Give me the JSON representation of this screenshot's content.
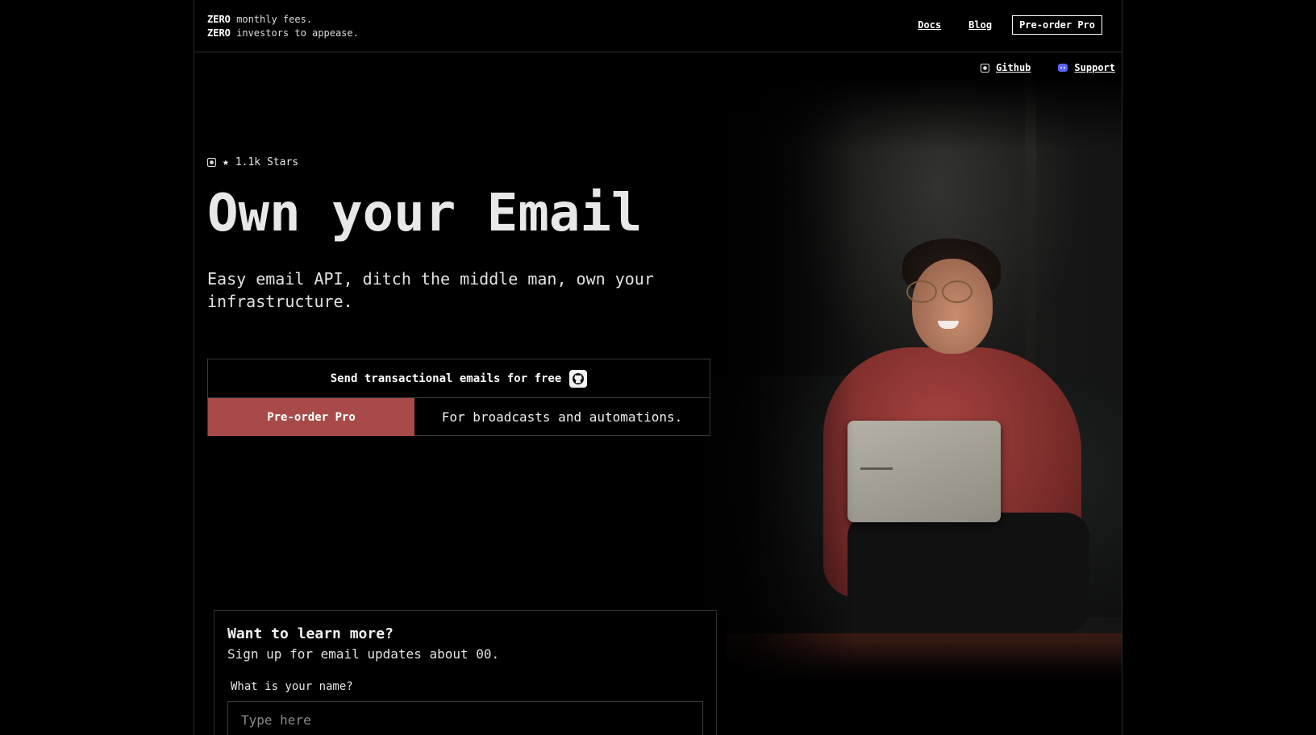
{
  "header": {
    "tagline_line1_bold": "ZERO",
    "tagline_line1_rest": " monthly fees.",
    "tagline_line2_bold": "ZERO",
    "tagline_line2_rest": " investors to appease.",
    "nav": {
      "docs": "Docs",
      "blog": "Blog",
      "preorder": "Pre-order Pro"
    },
    "subnav": {
      "github": "Github",
      "support": "Support"
    }
  },
  "hero": {
    "stars": "1.1k Stars",
    "title": "Own your Email",
    "subtitle": "Easy email API, ditch the middle man, own your infrastructure.",
    "cta_free": "Send transactional emails for free",
    "cta_preorder": "Pre-order Pro",
    "cta_desc": "For broadcasts and automations."
  },
  "signup": {
    "title": "Want to learn more?",
    "subtitle": "Sign up for email updates about 00.",
    "name_label": "What is your name?",
    "name_placeholder": "Type here"
  },
  "colors": {
    "accent": "#a84a4a",
    "background": "#000000",
    "text": "#e8e8e8"
  },
  "icons": [
    "github-icon",
    "star-icon",
    "discord-icon",
    "github-square-icon"
  ]
}
